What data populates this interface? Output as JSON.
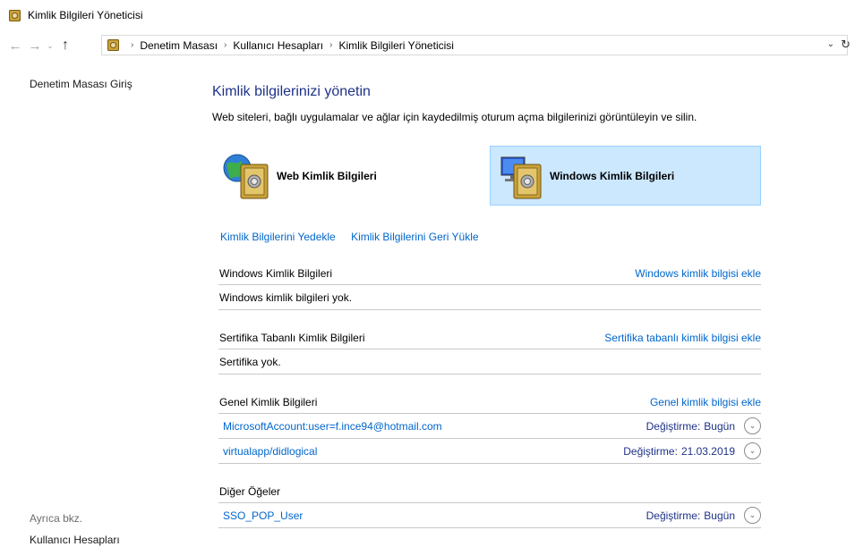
{
  "window": {
    "title": "Kimlik Bilgileri Yöneticisi"
  },
  "breadcrumb": [
    "Denetim Masası",
    "Kullanıcı Hesapları",
    "Kimlik Bilgileri Yöneticisi"
  ],
  "icons": {
    "back": "back-arrow-icon",
    "forward": "forward-arrow-icon",
    "recent": "chevron-down-icon",
    "up": "up-arrow-icon",
    "refresh": "refresh-icon",
    "vault": "credential-vault-icon"
  },
  "left_pane": {
    "home": "Denetim Masası Giriş",
    "see_also": "Ayrıca bkz.",
    "user_accounts": "Kullanıcı Hesapları"
  },
  "main": {
    "heading": "Kimlik bilgilerinizi yönetin",
    "subtitle": "Web siteleri, bağlı uygulamalar ve ağlar için kaydedilmiş oturum açma bilgilerinizi görüntüleyin ve silin.",
    "type_buttons": {
      "web": "Web Kimlik Bilgileri",
      "windows": "Windows Kimlik Bilgileri"
    },
    "backup_link": "Kimlik Bilgilerini Yedekle",
    "restore_link": "Kimlik Bilgilerini Geri Yükle",
    "sections": {
      "windows": {
        "title": "Windows Kimlik Bilgileri",
        "add": "Windows kimlik bilgisi ekle",
        "empty": "Windows kimlik bilgileri yok."
      },
      "certificate": {
        "title": "Sertifika Tabanlı Kimlik Bilgileri",
        "add": "Sertifika tabanlı kimlik bilgisi ekle",
        "empty": "Sertifika yok."
      },
      "generic": {
        "title": "Genel Kimlik Bilgileri",
        "add": "Genel kimlik bilgisi ekle",
        "items": [
          {
            "name": "MicrosoftAccount:user=f.ince94@hotmail.com",
            "modified_label": "Değiştirme:",
            "modified": "Bugün"
          },
          {
            "name": "virtualapp/didlogical",
            "modified_label": "Değiştirme:",
            "modified": "21.03.2019"
          }
        ]
      },
      "other": {
        "title": "Diğer Öğeler",
        "items": [
          {
            "name": "SSO_POP_User",
            "modified_label": "Değiştirme:",
            "modified": "Bugün"
          }
        ]
      }
    }
  },
  "colors": {
    "link": "#0066cc",
    "heading": "#1e3287",
    "selected_bg": "#cce8ff",
    "selected_border": "#99d1ff"
  }
}
